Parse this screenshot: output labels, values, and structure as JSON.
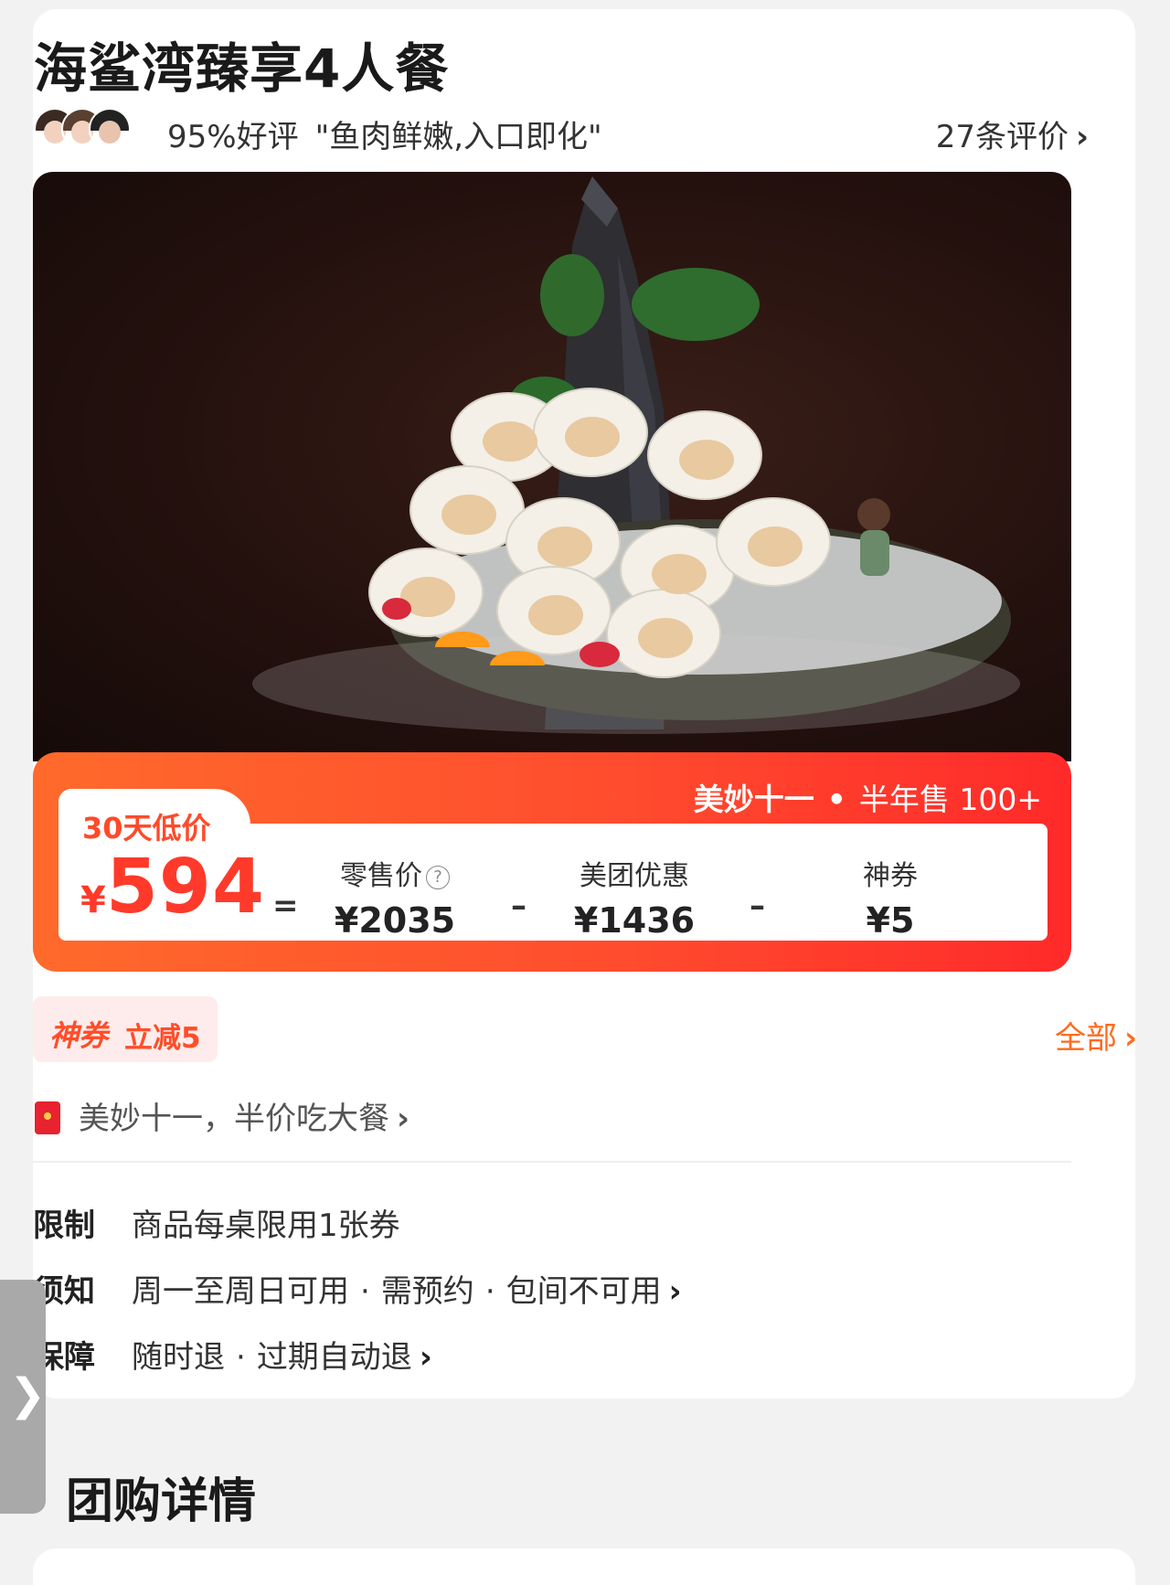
{
  "deal": {
    "title": "海鲨湾臻享4人餐",
    "rating": "95%好评",
    "quote": "\"鱼肉鲜嫩,入口即化\"",
    "reviews_link": "27条评价"
  },
  "promo": {
    "tag": "美妙十一",
    "dot": "•",
    "sales": "半年售 100+"
  },
  "price": {
    "low_label": "30天低价",
    "currency": "¥",
    "final": "594",
    "equals": "=",
    "minus": "–",
    "retail_label": "零售价",
    "retail_value": "¥2035",
    "meituan_label": "美团优惠",
    "meituan_value": "¥1436",
    "coupon_label": "神券",
    "coupon_value": "¥5"
  },
  "coupon": {
    "name": "神券",
    "desc": "立减5",
    "all_link": "全部"
  },
  "event": {
    "text": "美妙十一，半价吃大餐"
  },
  "rules": [
    {
      "key": "限制",
      "value": "商品每桌限用1张券"
    },
    {
      "key": "须知",
      "parts": [
        "周一至周日可用",
        "需预约",
        "包间不可用"
      ]
    },
    {
      "key": "保障",
      "parts": [
        "随时退",
        "过期自动退"
      ]
    }
  ],
  "rule_sep": "·",
  "side_tab": "❯",
  "section_title": "团购详情",
  "colors": {
    "accent": "#ff4d2e",
    "price_red": "#ff3a2a",
    "link_orange": "#ff6a1e"
  }
}
